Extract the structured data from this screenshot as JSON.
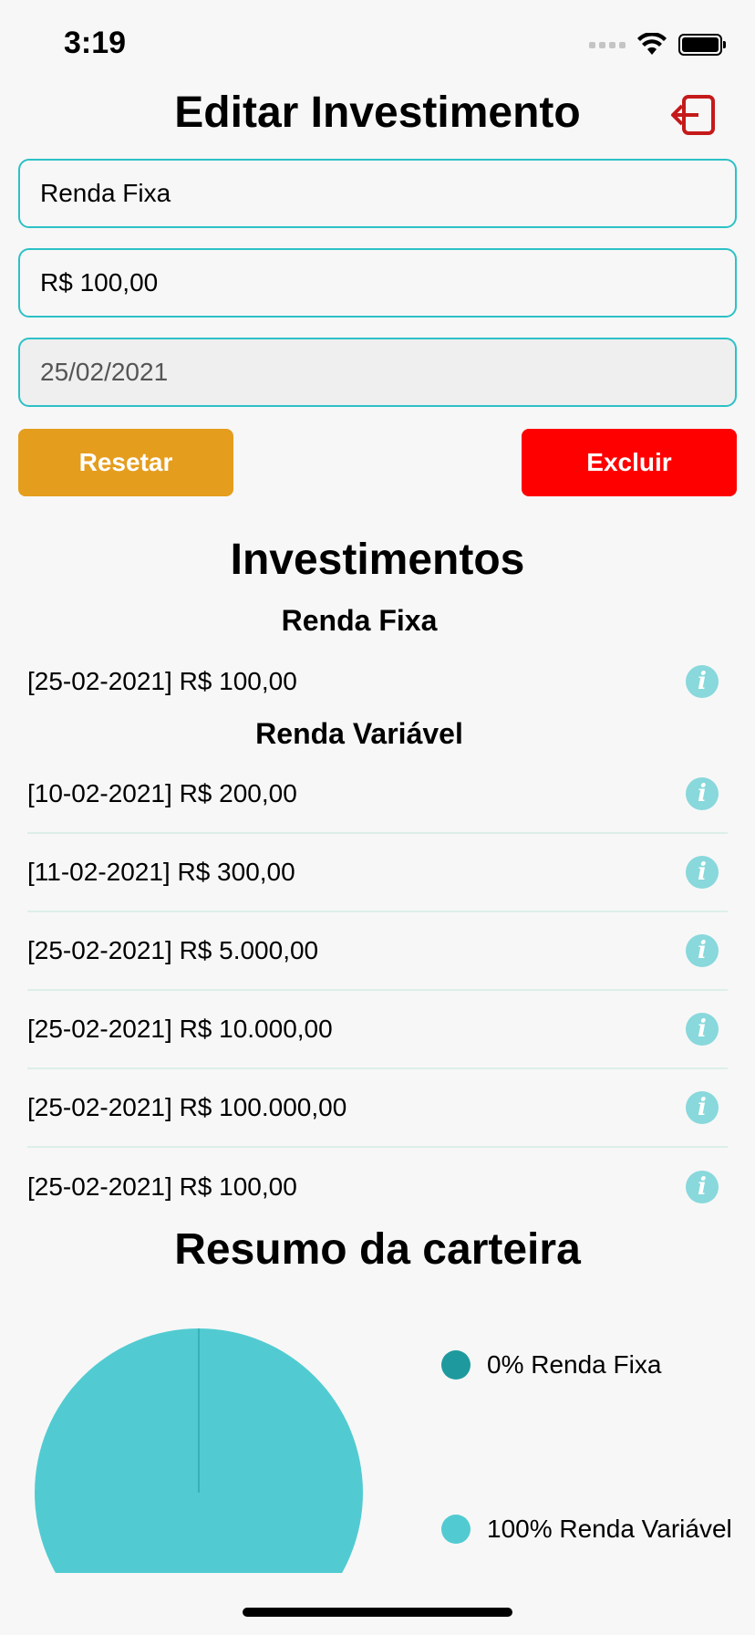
{
  "status": {
    "time": "3:19"
  },
  "header": {
    "title": "Editar Investimento",
    "logout_icon": "logout-icon",
    "logout_color": "#c51a1a"
  },
  "form": {
    "type_value": "Renda Fixa",
    "amount_value": "R$ 100,00",
    "date_value": "25/02/2021",
    "reset_label": "Resetar",
    "delete_label": "Excluir",
    "reset_color": "#e59d1d",
    "delete_color": "#ff0000",
    "accent_color": "#2cc1c6"
  },
  "investments": {
    "title": "Investimentos",
    "groups": [
      {
        "name": "Renda Fixa",
        "items": [
          "[25-02-2021] R$ 100,00"
        ]
      },
      {
        "name": "Renda Variável",
        "items": [
          "[10-02-2021] R$ 200,00",
          "[11-02-2021] R$ 300,00",
          "[25-02-2021] R$ 5.000,00",
          "[25-02-2021] R$ 10.000,00",
          "[25-02-2021] R$ 100.000,00",
          "[25-02-2021] R$ 100,00"
        ]
      }
    ],
    "info_icon": "info-icon"
  },
  "summary": {
    "title": "Resumo da carteira",
    "legend": [
      {
        "label": "0% Renda Fixa",
        "color": "#1e9a9e"
      },
      {
        "label": "100% Renda Variável",
        "color": "#51cbd1"
      }
    ]
  },
  "chart_data": {
    "type": "pie",
    "categories": [
      "Renda Fixa",
      "Renda Variável"
    ],
    "values": [
      0,
      100
    ],
    "colors": [
      "#1e9a9e",
      "#51cbd1"
    ]
  }
}
